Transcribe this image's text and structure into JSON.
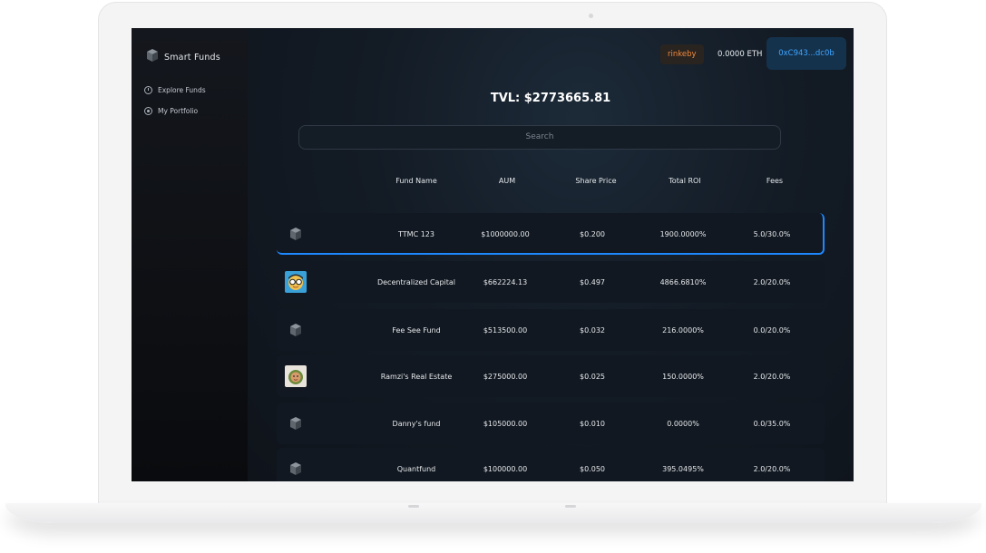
{
  "brand": {
    "name": "Smart Funds",
    "icon": "cube-icon"
  },
  "sidebar": {
    "items": [
      {
        "label": "Explore Funds",
        "icon": "clock-icon"
      },
      {
        "label": "My Portfolio",
        "icon": "target-icon"
      }
    ]
  },
  "header": {
    "network": "rinkeby",
    "balance": "0.0000 ETH",
    "address": "0xC943...dc0b"
  },
  "tvl": "TVL: $2773665.81",
  "search": {
    "placeholder": "Search",
    "value": ""
  },
  "table": {
    "columns": [
      "Fund Name",
      "AUM",
      "Share Price",
      "Total ROI",
      "Fees"
    ],
    "rows": [
      {
        "icon": "cube-icon",
        "name": "TTMC 123",
        "aum": "$1000000.00",
        "price": "$0.200",
        "roi": "1900.0000%",
        "fees": "5.0/30.0%",
        "selected": true
      },
      {
        "icon": "avatar-glasses-icon",
        "name": "Decentralized Capital",
        "aum": "$662224.13",
        "price": "$0.497",
        "roi": "4866.6810%",
        "fees": "2.0/20.0%"
      },
      {
        "icon": "cube-icon",
        "name": "Fee See Fund",
        "aum": "$513500.00",
        "price": "$0.032",
        "roi": "216.0000%",
        "fees": "0.0/20.0%"
      },
      {
        "icon": "avatar-face-icon",
        "name": "Ramzi's Real Estate",
        "aum": "$275000.00",
        "price": "$0.025",
        "roi": "150.0000%",
        "fees": "2.0/20.0%"
      },
      {
        "icon": "cube-icon",
        "name": "Danny's fund",
        "aum": "$105000.00",
        "price": "$0.010",
        "roi": "0.0000%",
        "fees": "0.0/35.0%"
      },
      {
        "icon": "cube-icon",
        "name": "Quantfund",
        "aum": "$100000.00",
        "price": "$0.050",
        "roi": "395.0495%",
        "fees": "2.0/20.0%"
      }
    ]
  },
  "colors": {
    "accent": "#1e88ff",
    "address": "#3ea6ff",
    "network": "#f08a3c"
  }
}
